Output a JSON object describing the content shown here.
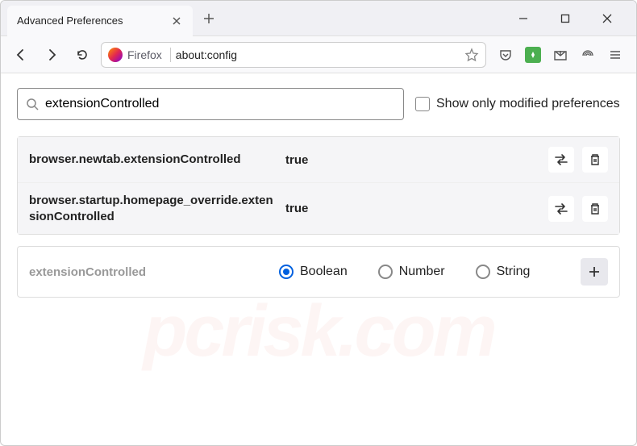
{
  "window": {
    "tab_title": "Advanced Preferences"
  },
  "urlbar": {
    "identity": "Firefox",
    "url": "about:config"
  },
  "search": {
    "value": "extensionControlled",
    "checkbox_label": "Show only modified preferences"
  },
  "prefs": [
    {
      "name": "browser.newtab.extensionControlled",
      "value": "true"
    },
    {
      "name": "browser.startup.homepage_override.extensionControlled",
      "value": "true"
    }
  ],
  "add": {
    "name": "extensionControlled",
    "options": [
      "Boolean",
      "Number",
      "String"
    ],
    "selected": "Boolean"
  },
  "watermark": "pcrisk.com"
}
